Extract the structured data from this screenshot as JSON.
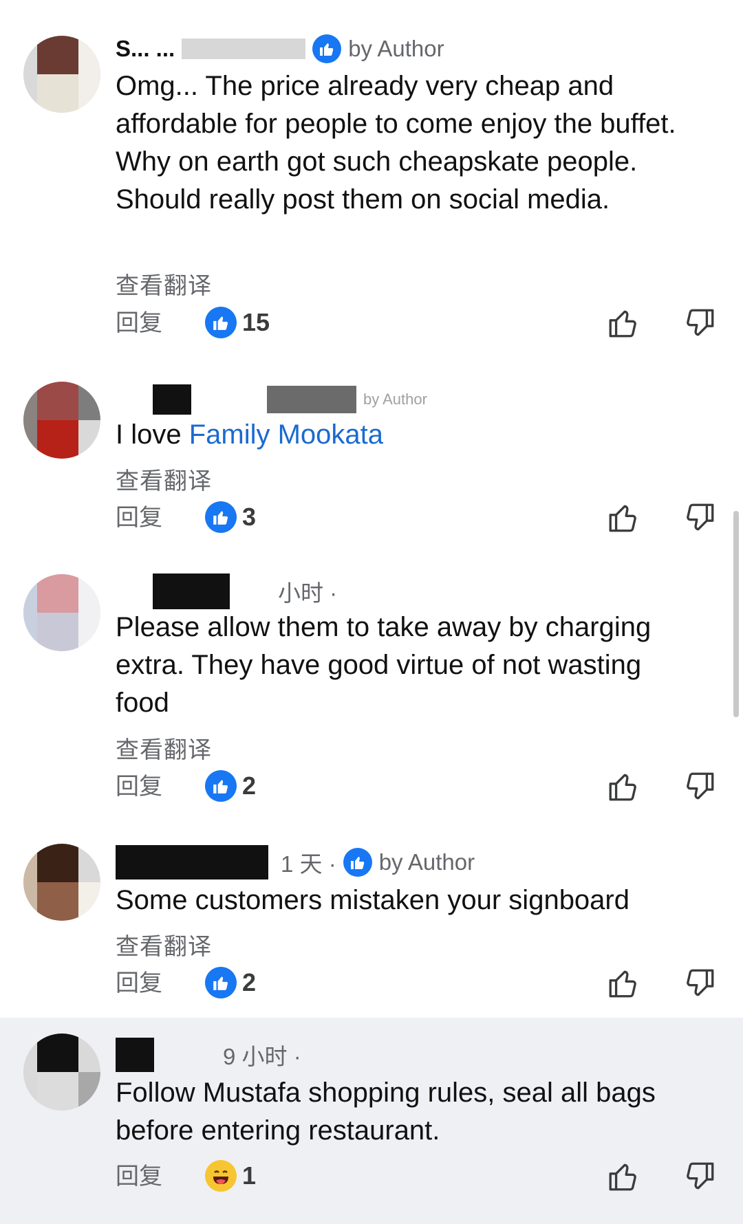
{
  "comments": [
    {
      "author": "S... ...",
      "time": "",
      "author_badge": "by Author",
      "text_plain": "Omg... The price already very cheap and affordable for people to come enjoy the buffet. Why on earth got such cheapskate people. Should really post them on social media.",
      "translate": "查看翻译",
      "reply": "回复",
      "reaction_type": "like",
      "reaction_count": "15"
    },
    {
      "author": "",
      "time": "",
      "author_badge": "by Author",
      "text_prefix": "I love ",
      "text_link": "Family Mookata",
      "translate": "查看翻译",
      "reply": "回复",
      "reaction_type": "like",
      "reaction_count": "3"
    },
    {
      "author": "",
      "time": "小时 ·",
      "author_badge": "",
      "text_plain": "Please allow them to take away by charging extra. They have good virtue of not wasting food",
      "translate": "查看翻译",
      "reply": "回复",
      "reaction_type": "like",
      "reaction_count": "2"
    },
    {
      "author": "",
      "time": "1 天 ·",
      "author_badge": "by Author",
      "text_plain": "Some customers mistaken your signboard",
      "translate": "查看翻译",
      "reply": "回复",
      "reaction_type": "like",
      "reaction_count": "2"
    },
    {
      "author": "",
      "time": "9 小时 ·",
      "author_badge": "",
      "text_plain": "Follow Mustafa shopping rules, seal all bags before entering restaurant.",
      "translate": "",
      "reply": "回复",
      "reaction_type": "haha",
      "reaction_count": "1"
    }
  ],
  "icons": {
    "like": "thumbs-up-icon",
    "dislike": "thumbs-down-icon",
    "haha": "laughing-emoji-icon"
  },
  "colors": {
    "brand_blue": "#1877f2",
    "link_blue": "#1a6ad1",
    "muted_text": "#65676b",
    "highlight_bg": "#eef0f4"
  }
}
